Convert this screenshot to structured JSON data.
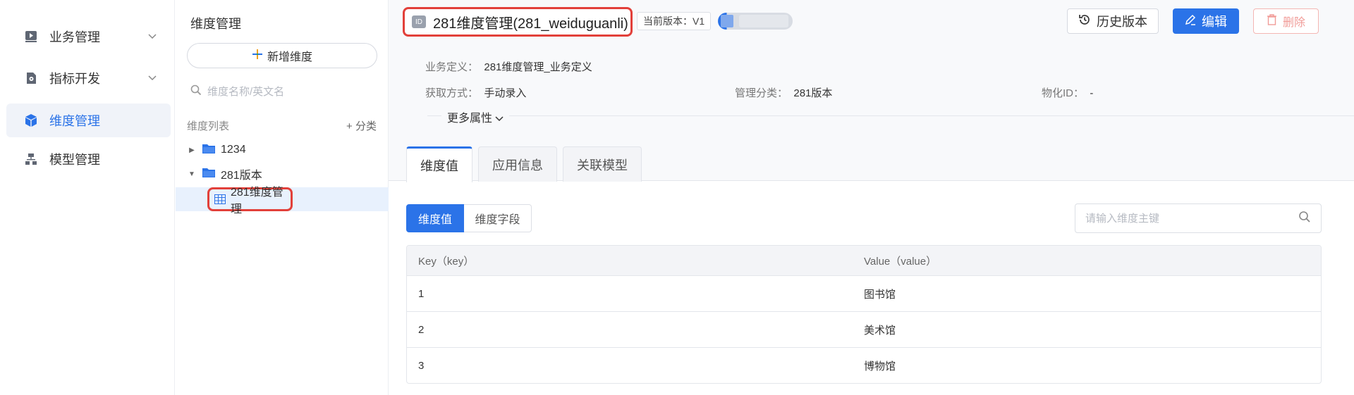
{
  "nav": {
    "items": [
      {
        "label": "业务管理",
        "icon": "play-doc-icon",
        "expandable": true
      },
      {
        "label": "指标开发",
        "icon": "gear-doc-icon",
        "expandable": true
      },
      {
        "label": "维度管理",
        "icon": "cube-icon",
        "expandable": false,
        "active": true
      },
      {
        "label": "模型管理",
        "icon": "hierarchy-icon",
        "expandable": false
      }
    ]
  },
  "tree": {
    "title": "维度管理",
    "add_button": "新增维度",
    "search_placeholder": "维度名称/英文名",
    "list_label": "维度列表",
    "add_category": "分类",
    "nodes": [
      {
        "label": "1234",
        "expanded": false
      },
      {
        "label": "281版本",
        "expanded": true
      }
    ],
    "selected_leaf": "281维度管理"
  },
  "detail": {
    "id_badge": "ID",
    "title": "281维度管理(281_weiduguanli)",
    "current_version": "当前版本：V1",
    "history_button": "历史版本",
    "edit_button": "编辑",
    "delete_button": "删除",
    "fields": {
      "biz_def_label": "业务定义：",
      "biz_def_value": "281维度管理_业务定义",
      "acquire_label": "获取方式：",
      "acquire_value": "手动录入",
      "category_label": "管理分类：",
      "category_value": "281版本",
      "mat_label": "物化ID：",
      "mat_value": "-"
    },
    "more_attrs": "更多属性",
    "tabs": [
      "维度值",
      "应用信息",
      "关联模型"
    ],
    "segment": {
      "on": "维度值",
      "off": "维度字段"
    },
    "key_search_placeholder": "请输入维度主键",
    "table": {
      "headers": [
        "Key（key）",
        "Value（value）"
      ],
      "rows": [
        {
          "key": "1",
          "value": "图书馆"
        },
        {
          "key": "2",
          "value": "美术馆"
        },
        {
          "key": "3",
          "value": "博物馆"
        }
      ]
    }
  },
  "colors": {
    "primary": "#2b73e8",
    "highlight": "#e2403a",
    "danger": "#f19c98"
  }
}
